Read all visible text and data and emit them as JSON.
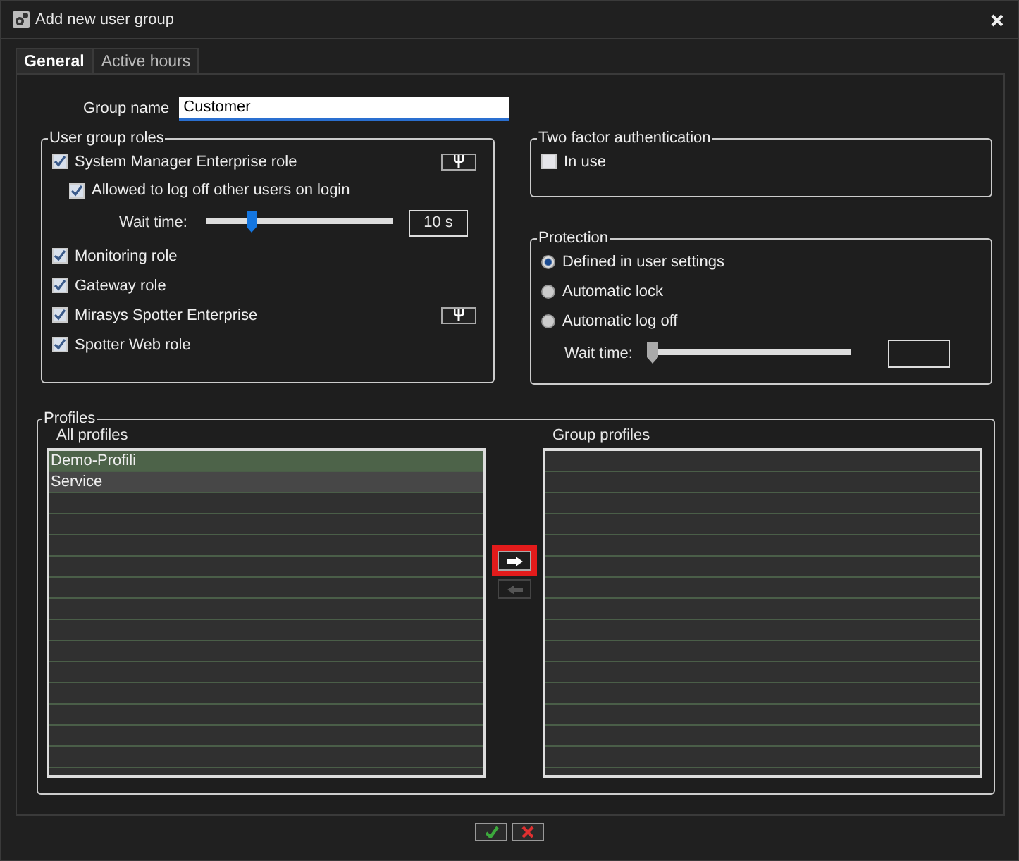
{
  "window": {
    "title": "Add new user group"
  },
  "tabs": [
    {
      "label": "General",
      "selected": true
    },
    {
      "label": "Active hours",
      "selected": false
    }
  ],
  "group_name": {
    "label": "Group name",
    "value": "Customer"
  },
  "user_group_roles": {
    "title": "User group roles",
    "items": [
      {
        "label": "System Manager Enterprise role",
        "checked": true,
        "settings_button": true,
        "children": [
          {
            "label": "Allowed to log off other users on login",
            "checked": true
          }
        ],
        "wait_time": {
          "label": "Wait time:",
          "level": 0.23,
          "reading": "10 s"
        }
      },
      {
        "label": "Monitoring role",
        "checked": true,
        "settings_button": false
      },
      {
        "label": "Gateway role",
        "checked": true,
        "settings_button": false
      },
      {
        "label": "Mirasys Spotter Enterprise",
        "checked": true,
        "settings_button": true
      },
      {
        "label": "Spotter Web role",
        "checked": true,
        "settings_button": false
      }
    ]
  },
  "two_factor_authentication": {
    "title": "Two factor authentication",
    "in_use": {
      "label": "In use",
      "checked": false
    }
  },
  "protection": {
    "title": "Protection",
    "options": [
      {
        "label": "Defined in user settings",
        "selected": true
      },
      {
        "label": "Automatic lock",
        "selected": false
      },
      {
        "label": "Automatic log off",
        "selected": false
      }
    ],
    "wait_time": {
      "label": "Wait time:",
      "level": 0
    }
  },
  "profiles": {
    "title": "Profiles",
    "all_profiles": {
      "title": "All profiles",
      "rows": [
        {
          "name": "Demo-Profili",
          "selected": true,
          "hovered": false
        },
        {
          "name": "Service",
          "selected": false,
          "hovered": true
        }
      ]
    },
    "add_button": {
      "disabled": false,
      "highlighted": true
    },
    "remove_button": {
      "disabled": true,
      "highlighted": false
    },
    "group_profiles": {
      "title": "Group profiles"
    }
  }
}
